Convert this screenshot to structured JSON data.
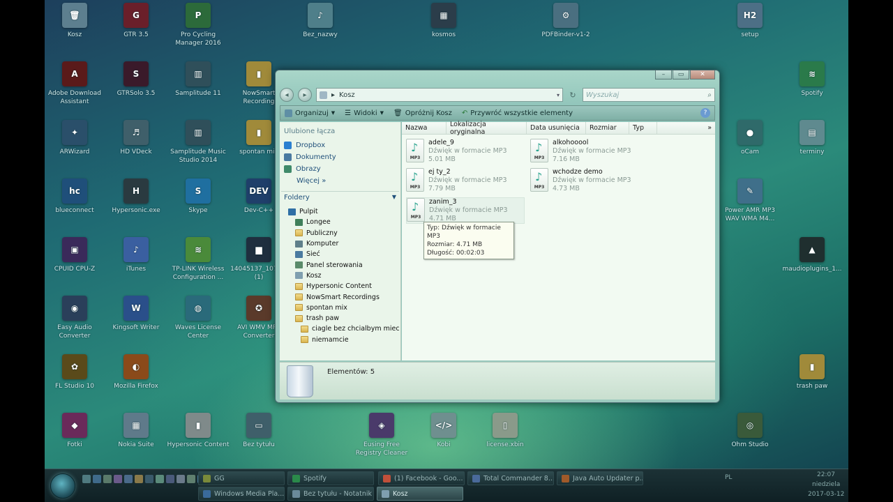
{
  "desktop_icons": [
    {
      "label": "Kosz",
      "glyph": "🗑",
      "color": "#5d7f8f"
    },
    {
      "label": "GTR 3.5",
      "glyph": "G",
      "color": "#6a1f2a"
    },
    {
      "label": "Pro Cycling Manager 2016",
      "glyph": "P",
      "color": "#2c6a3a"
    },
    {
      "label": "Bez_nazwy",
      "glyph": "♪",
      "color": "#4f7f8a"
    },
    {
      "label": "kosmos",
      "glyph": "▦",
      "color": "#2b3d4a"
    },
    {
      "label": "PDFBinder-v1-2",
      "glyph": "⚙",
      "color": "#4a6f80"
    },
    {
      "label": "setup",
      "glyph": "H2",
      "color": "#4d6f86"
    },
    {
      "label": "Adobe Download Assistant",
      "glyph": "A",
      "color": "#5a1a1a"
    },
    {
      "label": "GTRSolo 3.5",
      "glyph": "S",
      "color": "#3a1a2a"
    },
    {
      "label": "Samplitude 11",
      "glyph": "▥",
      "color": "#2f4f5a"
    },
    {
      "label": "NowSmart Recording",
      "glyph": "▮",
      "color": "#a08a3a"
    },
    {
      "label": "Spotify",
      "glyph": "≋",
      "color": "#2a7a4a"
    },
    {
      "label": "ARWizard",
      "glyph": "✦",
      "color": "#2a4f6a"
    },
    {
      "label": "HD VDeck",
      "glyph": "♬",
      "color": "#3f5f6a"
    },
    {
      "label": "Samplitude Music Studio 2014",
      "glyph": "▥",
      "color": "#2f4f5a"
    },
    {
      "label": "spontan mix",
      "glyph": "▮",
      "color": "#a08a3a"
    },
    {
      "label": "oCam",
      "glyph": "●",
      "color": "#2f6a6a"
    },
    {
      "label": "terminy",
      "glyph": "▤",
      "color": "#5f8a8f"
    },
    {
      "label": "blueconnect",
      "glyph": "hc",
      "color": "#1f4f7a"
    },
    {
      "label": "Hypersonic.exe",
      "glyph": "H",
      "color": "#2a3a40"
    },
    {
      "label": "Skype",
      "glyph": "S",
      "color": "#1f6fa0"
    },
    {
      "label": "Dev-C++",
      "glyph": "DEV",
      "color": "#1f3f6a"
    },
    {
      "label": "Power AMR MP3 WAV WMA M4...",
      "glyph": "✎",
      "color": "#3f6f8a"
    },
    {
      "label": "CPUID CPU-Z",
      "glyph": "▣",
      "color": "#3a2a5a"
    },
    {
      "label": "iTunes",
      "glyph": "♪",
      "color": "#3a5fa0"
    },
    {
      "label": "TP-LINK Wireless Configuration ...",
      "glyph": "≋",
      "color": "#4a8a3a"
    },
    {
      "label": "14045137_1073... (1)",
      "glyph": "▆",
      "color": "#1f2f3f"
    },
    {
      "label": "maudioplugins_1...",
      "glyph": "▲",
      "color": "#1f2f2f"
    },
    {
      "label": "Easy Audio Converter",
      "glyph": "◉",
      "color": "#2a3f5a"
    },
    {
      "label": "Kingsoft Writer",
      "glyph": "W",
      "color": "#2a4f8a"
    },
    {
      "label": "Waves License Center",
      "glyph": "◍",
      "color": "#2a6a7a"
    },
    {
      "label": "AVI WMV MP4 Converter",
      "glyph": "✪",
      "color": "#5a3a2a"
    },
    {
      "label": "FL Studio 10",
      "glyph": "✿",
      "color": "#5a4a1a"
    },
    {
      "label": "Mozilla Firefox",
      "glyph": "◐",
      "color": "#8a4a1a"
    },
    {
      "label": "trash paw",
      "glyph": "▮",
      "color": "#a08a3a"
    },
    {
      "label": "Fotki",
      "glyph": "◆",
      "color": "#6a2a5a"
    },
    {
      "label": "Nokia Suite",
      "glyph": "▦",
      "color": "#5f7a8a"
    },
    {
      "label": "Hypersonic Content",
      "glyph": "▮",
      "color": "#7f8a8a"
    },
    {
      "label": "Bez tytułu",
      "glyph": "▭",
      "color": "#3f5f6a"
    },
    {
      "label": "Eusing Free Registry Cleaner",
      "glyph": "◈",
      "color": "#4a3a6a"
    },
    {
      "label": "Kobi",
      "glyph": "</>",
      "color": "#6f8f8f"
    },
    {
      "label": "license.xbin",
      "glyph": "▯",
      "color": "#8a9a8a"
    },
    {
      "label": "Ohm Studio",
      "glyph": "◎",
      "color": "#3a5a3a"
    }
  ],
  "window": {
    "title_controls": [
      "–",
      "▭",
      "✕"
    ],
    "address": {
      "path": "Kosz",
      "separator": "▸",
      "dropdown": "▾"
    },
    "nav": {
      "back": "◂",
      "forward": "▸",
      "refresh": "↻"
    },
    "search": {
      "placeholder": "Wyszukaj",
      "icon": "⌕"
    },
    "toolbar": {
      "organize": "Organizuj",
      "views": "Widoki",
      "empty_bin": "Opróżnij Kosz",
      "restore_all": "Przywróć wszystkie elementy",
      "help": "?"
    },
    "favorites_title": "Ulubione łącza",
    "favorites": [
      {
        "label": "Dropbox",
        "color": "#2a7fd0"
      },
      {
        "label": "Dokumenty",
        "color": "#4a7aa0"
      },
      {
        "label": "Obrazy",
        "color": "#3f8a6a"
      }
    ],
    "more_label": "Więcej »",
    "folders_title": "Foldery",
    "tree": [
      {
        "label": "Pulpit",
        "indent": 0,
        "color": "#2f6fa5"
      },
      {
        "label": "Longee",
        "indent": 1,
        "color": "#3f7f5a"
      },
      {
        "label": "Publiczny",
        "indent": 1,
        "color": "folder"
      },
      {
        "label": "Komputer",
        "indent": 1,
        "color": "#5f7f8a"
      },
      {
        "label": "Sieć",
        "indent": 1,
        "color": "#4a7aa0"
      },
      {
        "label": "Panel sterowania",
        "indent": 1,
        "color": "#5a8a6a"
      },
      {
        "label": "Kosz",
        "indent": 1,
        "color": "#7f9faf"
      },
      {
        "label": "Hypersonic Content",
        "indent": 1,
        "color": "folder"
      },
      {
        "label": "NowSmart Recordings",
        "indent": 1,
        "color": "folder"
      },
      {
        "label": "spontan mix",
        "indent": 1,
        "color": "folder"
      },
      {
        "label": "trash paw",
        "indent": 1,
        "color": "folder"
      },
      {
        "label": "ciagle bez chcialbym miec mi",
        "indent": 2,
        "color": "folder"
      },
      {
        "label": "niemamcie",
        "indent": 2,
        "color": "folder"
      }
    ],
    "columns": [
      "Nazwa",
      "Lokalizacja oryginalna",
      "Data usunięcia",
      "Rozmiar",
      "Typ",
      "»"
    ],
    "files": [
      {
        "name": "adele_9",
        "type": "Dźwięk w formacie MP3",
        "size": "5.01 MB"
      },
      {
        "name": "alkohooool",
        "type": "Dźwięk w formacie MP3",
        "size": "7.16 MB"
      },
      {
        "name": "ej ty_2",
        "type": "Dźwięk w formacie MP3",
        "size": "7.79 MB"
      },
      {
        "name": "wchodze demo",
        "type": "Dźwięk w formacie MP3",
        "size": "4.73 MB"
      },
      {
        "name": "zanim_3",
        "type": "Dźwięk w formacie MP3",
        "size": "4.71 MB"
      }
    ],
    "file_icon_tag": "MP3",
    "tooltip": [
      "Typ: Dźwięk w formacie MP3",
      "Rozmiar: 4.71 MB",
      "Długość: 00:02:03"
    ],
    "details": {
      "count": "Elementów: 5"
    }
  },
  "taskbar": {
    "tasks_top": [
      {
        "label": "GG",
        "color": "#7a8a3a"
      },
      {
        "label": "Spotify",
        "color": "#2a8a4a"
      },
      {
        "label": "(1) Facebook - Goo...",
        "color": "#c0503a"
      },
      {
        "label": "Total Commander 8...",
        "color": "#4a6a9a"
      },
      {
        "label": "Java Auto Updater p...",
        "color": "#a05a2a"
      }
    ],
    "tasks_bottom": [
      {
        "label": "Windows Media Pla...",
        "color": "#3a6a9a",
        "active": false
      },
      {
        "label": "Bez tytułu - Notatnik",
        "color": "#6a8a9a",
        "active": false
      },
      {
        "label": "Kosz",
        "color": "#7f9faf",
        "active": true
      }
    ],
    "lang": "PL",
    "time": "22:07",
    "day": "niedziela",
    "date": "2017-03-12"
  }
}
